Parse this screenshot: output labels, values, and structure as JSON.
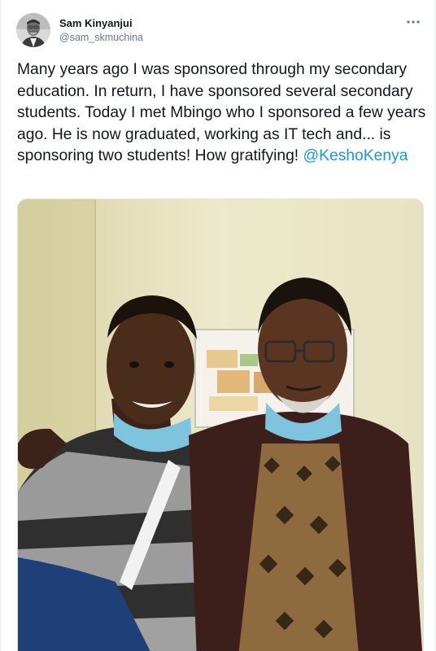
{
  "author": {
    "display_name": "Sam Kinyanjui",
    "handle": "@sam_skmuchina",
    "avatar_icon": "profile-photo"
  },
  "menu": {
    "icon": "more-dots-icon"
  },
  "tweet": {
    "text_before_mention": "Many years ago I was sponsored through my secondary education. In return, I  have sponsored several secondary students. Today I met Mbingo who I sponsored a few years ago. He is now graduated, working as IT tech and... is sponsoring two students! How gratifying! ",
    "mention": "@KeshoKenya"
  },
  "media": {
    "type": "photo",
    "description_icon": "photo-two-men"
  },
  "colors": {
    "link": "#1b95e0",
    "text": "#14171a",
    "secondary": "#657786"
  }
}
